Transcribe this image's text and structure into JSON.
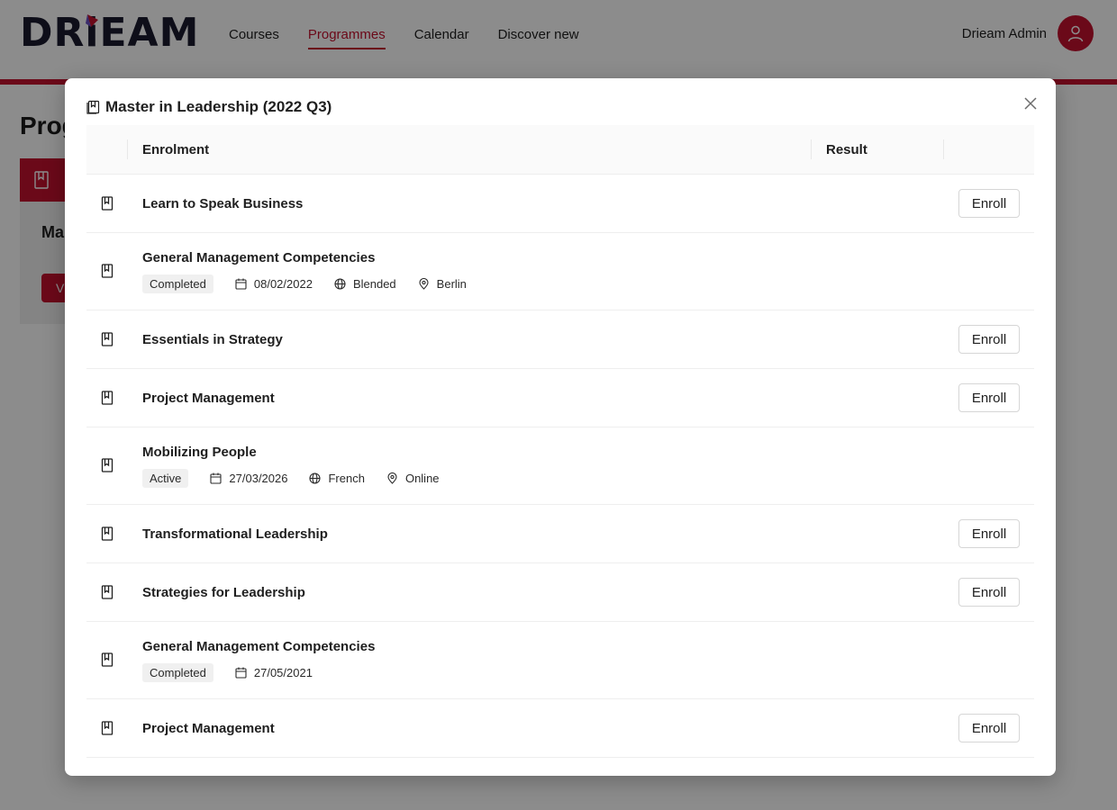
{
  "brand": {
    "logo_text": "DRiEAM",
    "accent": "#c4122f"
  },
  "nav": {
    "items": [
      {
        "label": "Courses",
        "active": false
      },
      {
        "label": "Programmes",
        "active": true
      },
      {
        "label": "Calendar",
        "active": false
      },
      {
        "label": "Discover new",
        "active": false
      }
    ]
  },
  "user": {
    "name": "Drieam Admin",
    "icon": "user-icon"
  },
  "background": {
    "heading": "Prog",
    "card_title": "Ma",
    "card_button": "V"
  },
  "modal": {
    "title": "Master in Leadership (2022 Q3)",
    "title_icon": "book-icon",
    "close_icon": "close-icon",
    "columns": {
      "enrolment": "Enrolment",
      "result": "Result"
    },
    "rows": [
      {
        "name": "Learn to Speak Business",
        "action": "Enroll"
      },
      {
        "name": "General Management Competencies",
        "status": "Completed",
        "date": "08/02/2022",
        "format": "Blended",
        "location": "Berlin"
      },
      {
        "name": "Essentials in Strategy",
        "action": "Enroll"
      },
      {
        "name": "Project Management",
        "action": "Enroll"
      },
      {
        "name": "Mobilizing People",
        "status": "Active",
        "date": "27/03/2026",
        "format": "French",
        "location": "Online"
      },
      {
        "name": "Transformational Leadership",
        "action": "Enroll"
      },
      {
        "name": "Strategies for Leadership",
        "action": "Enroll"
      },
      {
        "name": "General Management Competencies",
        "status": "Completed",
        "date": "27/05/2021"
      },
      {
        "name": "Project Management",
        "action": "Enroll"
      }
    ]
  }
}
